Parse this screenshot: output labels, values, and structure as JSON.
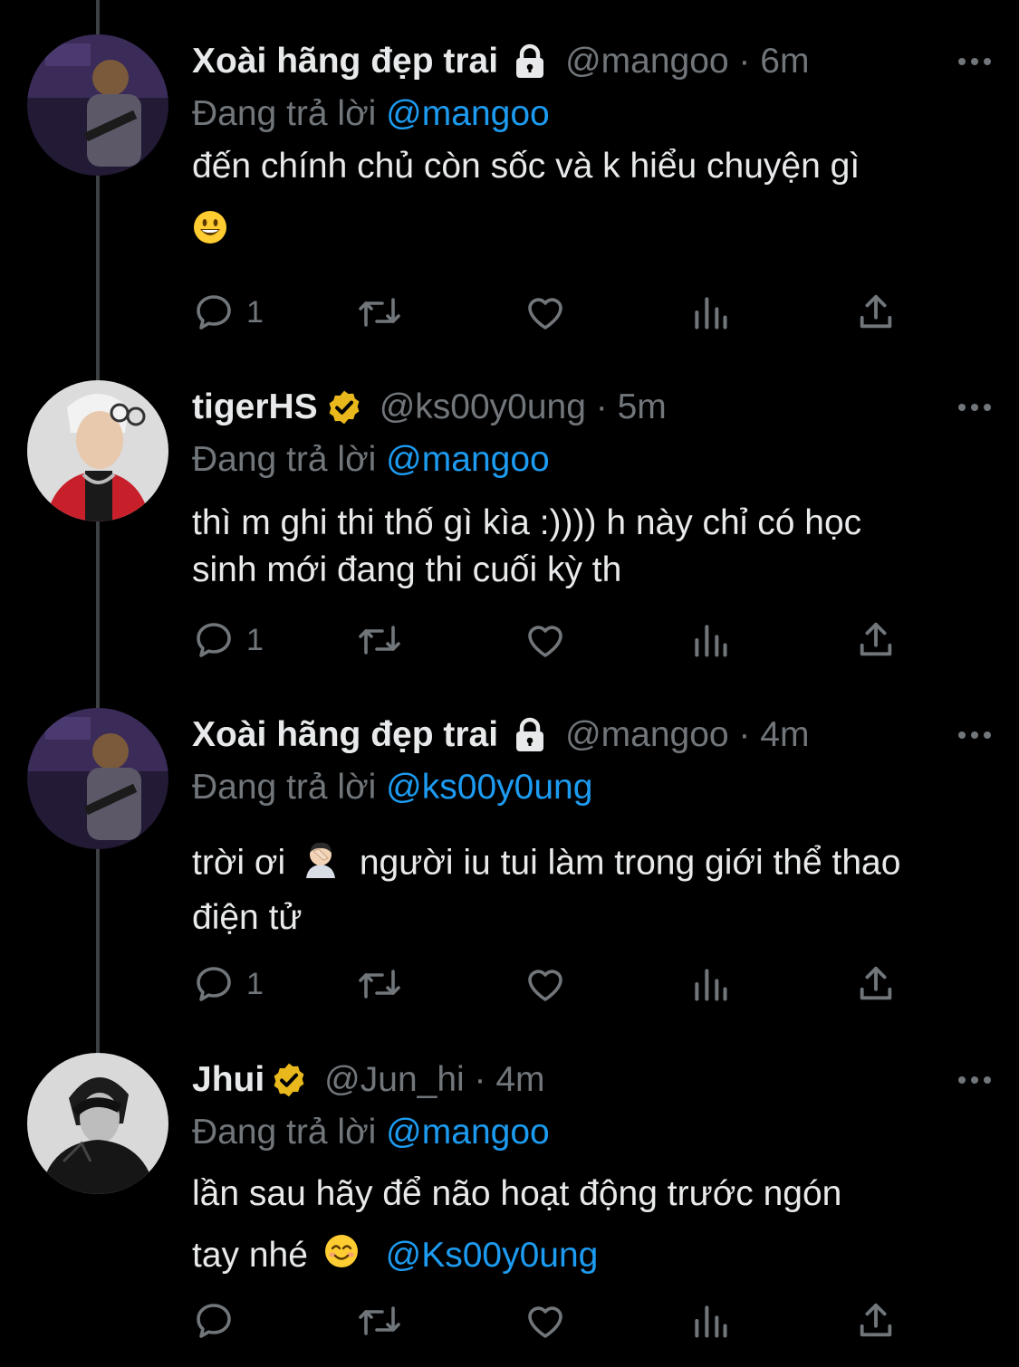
{
  "tweets": [
    {
      "name": "Xoài hãng đẹp trai",
      "badge_icon": "lock-icon",
      "handle": "@mangoo · 6m",
      "reply_prefix": "Đang trả lời",
      "reply_to": "@mangoo",
      "text_lines": [
        "đến chính chủ còn sốc và k hiểu chuyện gì"
      ],
      "emoji": "grinning-face-emoji",
      "reply_count": "1"
    },
    {
      "name": "tigerHS",
      "badge_icon": "verified-badge-icon",
      "handle": "@ks00y0ung · 5m",
      "reply_prefix": "Đang trả lời",
      "reply_to": "@mangoo",
      "text_lines": [
        "thì m ghi thi thố gì kìa :)))) h này chỉ có học",
        "sinh mới đang thi cuối kỳ th"
      ],
      "reply_count": "1"
    },
    {
      "name": "Xoài hãng đẹp trai",
      "badge_icon": "lock-icon",
      "handle": "@mangoo · 4m",
      "reply_prefix": "Đang trả lời",
      "reply_to": "@ks00y0ung",
      "text_before_emoji": "trời ơi",
      "emoji": "facepalm-emoji",
      "text_after_emoji": "người iu tui làm trong giới thể thao",
      "text_line2": "điện tử",
      "reply_count": "1"
    },
    {
      "name": "Jhui",
      "badge_icon": "verified-badge-icon",
      "handle": "@Jun_hi · 4m",
      "reply_prefix": "Đang trả lời",
      "reply_to": "@mangoo",
      "text_line1": "lần sau hãy để não hoạt động trước ngón",
      "text_line2_prefix": "tay nhé",
      "emoji": "smiling-face-emoji",
      "text_line2_mention": "@Ks00y0ung",
      "reply_count": ""
    }
  ],
  "colors": {
    "background": "#000000",
    "text": "#e7e9ea",
    "secondary": "#71767b",
    "link": "#1d9bf0",
    "verified": "#e8b81c"
  }
}
